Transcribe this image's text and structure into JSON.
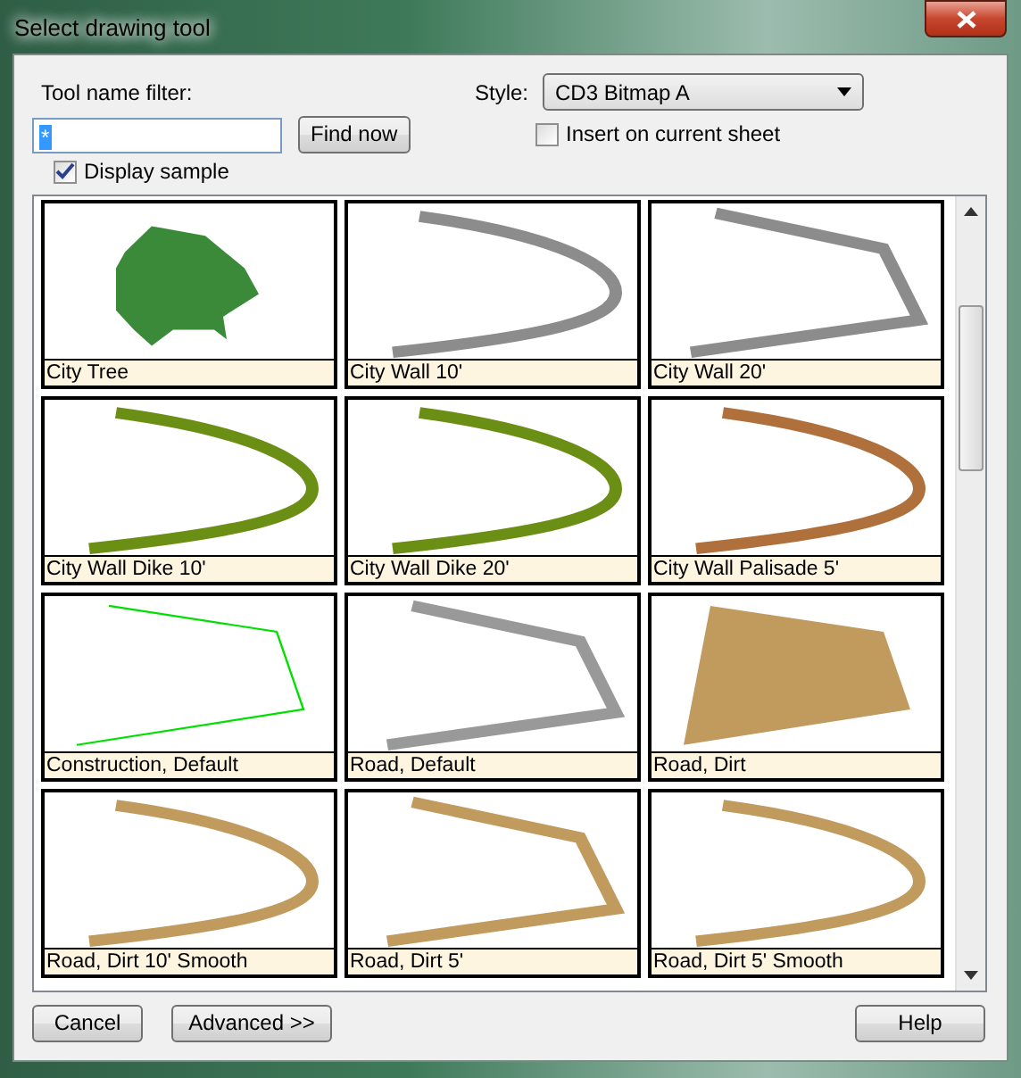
{
  "window": {
    "title": "Select drawing tool"
  },
  "filter": {
    "label": "Tool name filter:",
    "value": "*"
  },
  "find_button": "Find now",
  "style": {
    "label": "Style:",
    "value": "CD3 Bitmap A"
  },
  "insert_on_current_sheet": {
    "label": "Insert on current sheet",
    "checked": false
  },
  "display_sample": {
    "label": "Display sample",
    "checked": true
  },
  "tools": [
    {
      "label": "City Tree",
      "kind": "blob",
      "color": "#3a8a3a"
    },
    {
      "label": "City Wall 10'",
      "kind": "curve",
      "color": "#8c8c8c"
    },
    {
      "label": "City Wall 20'",
      "kind": "bend",
      "color": "#8c8c8c"
    },
    {
      "label": "City Wall Dike 10'",
      "kind": "curve",
      "color": "#6b8e14"
    },
    {
      "label": "City Wall Dike 20'",
      "kind": "curve",
      "color": "#6b8e14"
    },
    {
      "label": "City Wall Palisade 5'",
      "kind": "curve",
      "color": "#b0703c"
    },
    {
      "label": "Construction, Default",
      "kind": "outline",
      "color": "#00e000"
    },
    {
      "label": "Road, Default",
      "kind": "bend",
      "color": "#999999"
    },
    {
      "label": "Road, Dirt",
      "kind": "area",
      "color": "#c19a5e"
    },
    {
      "label": "Road, Dirt 10' Smooth",
      "kind": "curve",
      "color": "#c19a5e"
    },
    {
      "label": "Road, Dirt 5'",
      "kind": "bend",
      "color": "#c19a5e"
    },
    {
      "label": "Road, Dirt 5' Smooth",
      "kind": "curve",
      "color": "#c19a5e"
    }
  ],
  "buttons": {
    "cancel": "Cancel",
    "advanced": "Advanced >>",
    "help": "Help"
  }
}
